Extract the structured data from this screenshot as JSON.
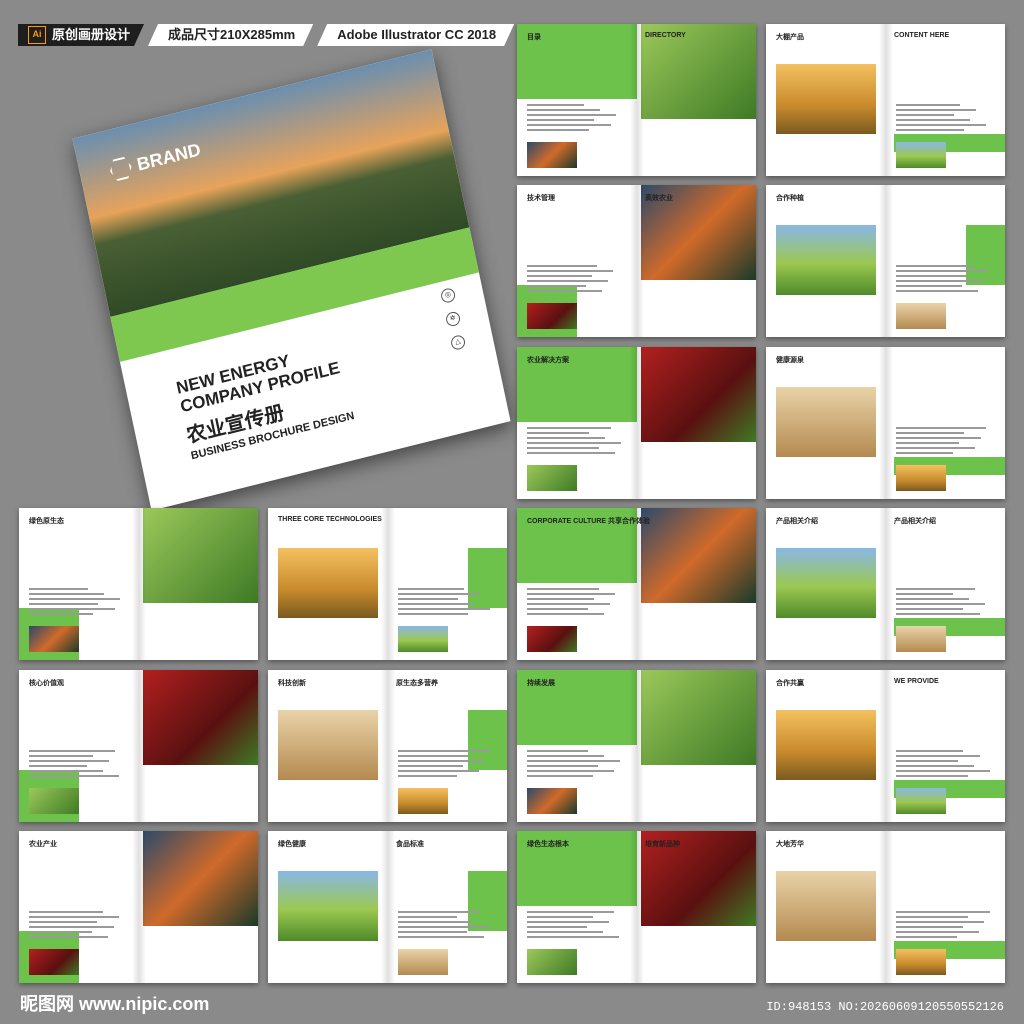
{
  "topbar": {
    "ai_icon": "Ai",
    "tag1": "原创画册设计",
    "tag2": "成品尺寸210X285mm",
    "tag3": "Adobe Illustrator CC 2018"
  },
  "cover": {
    "brand": "BRAND",
    "title_line1": "NEW ENERGY",
    "title_line2": "COMPANY PROFILE",
    "cn_title": "农业宣传册",
    "subtitle": "BUSINESS BROCHURE DESIGN"
  },
  "spreads": [
    {
      "left": "目录",
      "right": "DIRECTORY"
    },
    {
      "left": "大棚产品",
      "right": "CONTENT HERE"
    },
    {
      "left": "技术管理",
      "right": "高效农业"
    },
    {
      "left": "合作种植",
      "right": ""
    },
    {
      "left": "农业解决方案",
      "right": ""
    },
    {
      "left": "健康源泉",
      "right": ""
    },
    {
      "left": "绿色原生态",
      "right": ""
    },
    {
      "left": "THREE CORE TECHNOLOGIES",
      "right": ""
    },
    {
      "left": "CORPORATE CULTURE 共享合作体验",
      "right": ""
    },
    {
      "left": "产品相关介绍",
      "right": "产品相关介绍"
    },
    {
      "left": "核心价值观",
      "right": ""
    },
    {
      "left": "科技创新",
      "right": "原生态多营养"
    },
    {
      "left": "持续发展",
      "right": ""
    },
    {
      "left": "合作共赢",
      "right": "WE PROVIDE"
    },
    {
      "left": "农业产业",
      "right": ""
    },
    {
      "left": "绿色健康",
      "right": "食品标准"
    },
    {
      "left": "绿色生态根本",
      "right": "培育新品种"
    },
    {
      "left": "大地芳华",
      "right": ""
    }
  ],
  "footer": {
    "watermark": "昵图网 www.nipic.com",
    "id": "ID:948153 NO:20260609120550552126"
  }
}
